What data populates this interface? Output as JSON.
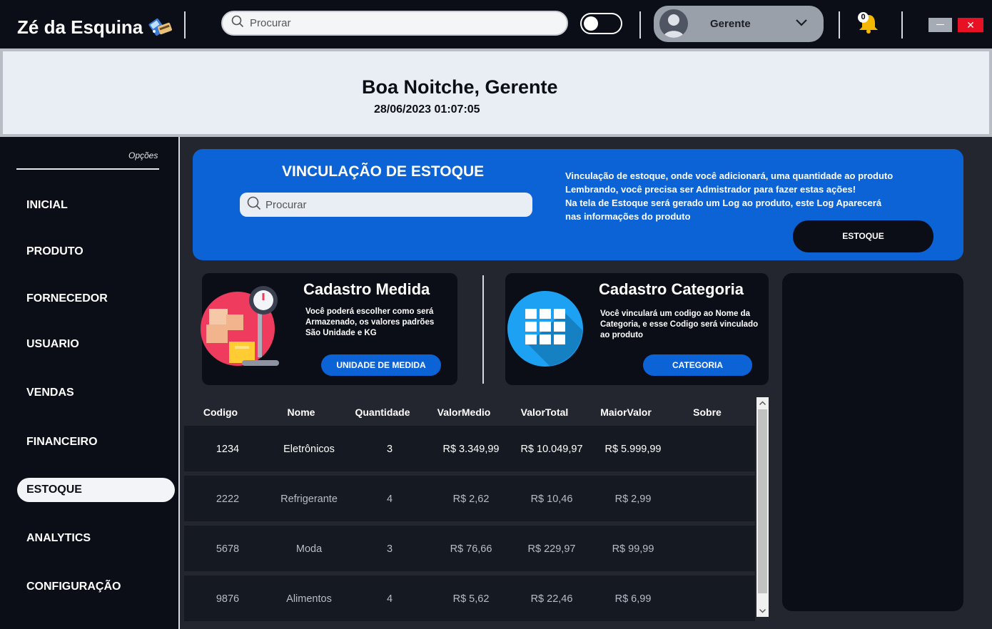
{
  "topbar": {
    "brand": "Zé da Esquina",
    "search_placeholder": "Procurar",
    "user_name": "Gerente",
    "notification_count": "0",
    "close_glyph": "✕"
  },
  "greeting": {
    "title": "Boa Noitche, Gerente",
    "datetime": "28/06/2023 01:07:05"
  },
  "sidebar": {
    "options_label": "Opções",
    "items": [
      {
        "label": "INICIAL",
        "active": false
      },
      {
        "label": "PRODUTO",
        "active": false
      },
      {
        "label": "FORNECEDOR",
        "active": false
      },
      {
        "label": "USUARIO",
        "active": false
      },
      {
        "label": "VENDAS",
        "active": false
      },
      {
        "label": "FINANCEIRO",
        "active": false
      },
      {
        "label": "ESTOQUE",
        "active": true
      },
      {
        "label": "ANALYTICS",
        "active": false
      },
      {
        "label": "CONFIGURAÇÃO",
        "active": false
      }
    ]
  },
  "banner": {
    "title": "VINCULAÇÃO DE ESTOQUE",
    "search_placeholder": "Procurar",
    "lines": [
      "Vinculação de estoque, onde você adicionará, uma quantidade ao produto",
      "Lembrando, você precisa ser Admistrador para fazer estas ações!",
      "Na tela de Estoque será gerado um Log ao produto, este Log Aparecerá",
      "nas informações do produto"
    ],
    "button": "ESTOQUE"
  },
  "card_medida": {
    "title": "Cadastro Medida",
    "desc_lines": [
      "Você poderá escolher como será",
      "Armazenado, os valores padrões",
      "São Unidade e KG"
    ],
    "button": "UNIDADE DE MEDIDA"
  },
  "card_categoria": {
    "title": "Cadastro Categoria",
    "desc_lines": [
      "Você vinculará um codigo ao Nome da",
      "Categoria, e esse Codigo será vinculado",
      "ao produto"
    ],
    "button": "CATEGORIA"
  },
  "table": {
    "headers": [
      "Codigo",
      "Nome",
      "Quantidade",
      "ValorMedio",
      "ValorTotal",
      "MaiorValor",
      "Sobre"
    ],
    "rows": [
      [
        "1234",
        "Eletrônicos",
        "3",
        "R$ 3.349,99",
        "R$ 10.049,97",
        "R$ 5.999,99",
        ""
      ],
      [
        "2222",
        "Refrigerante",
        "4",
        "R$ 2,62",
        "R$ 10,46",
        "R$ 2,99",
        ""
      ],
      [
        "5678",
        "Moda",
        "3",
        "R$ 76,66",
        "R$ 229,97",
        "R$ 99,99",
        ""
      ],
      [
        "9876",
        "Alimentos",
        "4",
        "R$ 5,62",
        "R$ 22,46",
        "R$ 6,99",
        ""
      ]
    ]
  },
  "colors": {
    "accent_blue": "#0b63d6",
    "dark_bg": "#0b0e17",
    "panel_bg": "#23262e",
    "row_bg": "#151922",
    "row_text_highlight": "#ffffff",
    "row_text_muted": "#b7bcc6"
  },
  "icons": {
    "brand": "pos-terminal-icon",
    "search": "search-icon",
    "avatar": "user-avatar-icon",
    "chevron": "chevron-down-icon",
    "bell": "bell-icon",
    "measure": "weighing-scale-boxes-icon",
    "category": "grid-category-icon"
  }
}
